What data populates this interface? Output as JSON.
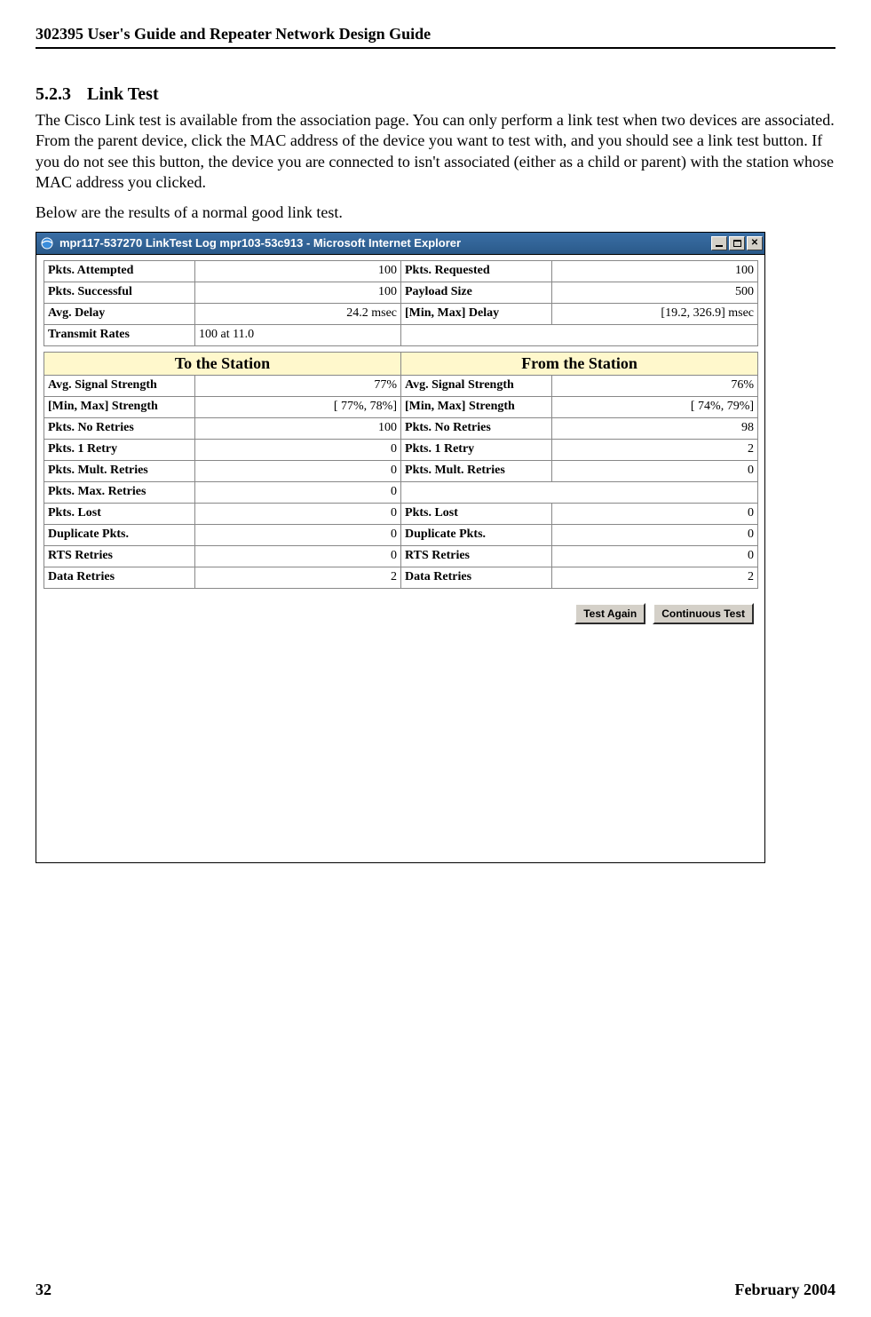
{
  "header": {
    "running_title": "302395 User's Guide and Repeater Network Design Guide"
  },
  "section": {
    "number": "5.2.3",
    "title": "Link Test",
    "para1": "The Cisco Link test is available from the association page. You can only perform a link test when two devices are associated. From the parent device, click the MAC address of the device you want to test with, and you should see a link test button. If you do not see this button, the device you are connected to isn't associated (either as a child or parent) with the station whose MAC address you clicked.",
    "para2": "Below are the results of a normal good link test."
  },
  "window": {
    "title": "mpr117-537270 LinkTest Log mpr103-53c913 - Microsoft Internet Explorer"
  },
  "top_rows": [
    {
      "l1": "Pkts. Attempted",
      "v1": "100",
      "l2": "Pkts. Requested",
      "v2": "100"
    },
    {
      "l1": "Pkts. Successful",
      "v1": "100",
      "l2": "Payload Size",
      "v2": "500"
    },
    {
      "l1": "Avg. Delay",
      "v1": "24.2 msec",
      "l2": "[Min, Max] Delay",
      "v2": "[19.2, 326.9] msec"
    },
    {
      "l1": "Transmit Rates",
      "v1": "100 at 11.0",
      "l2": "",
      "v2": ""
    }
  ],
  "station_headers": {
    "to": "To the Station",
    "from": "From the Station"
  },
  "station_rows": [
    {
      "l1": "Avg. Signal Strength",
      "v1": "77%",
      "l2": "Avg. Signal Strength",
      "v2": "76%"
    },
    {
      "l1": "[Min, Max] Strength",
      "v1": "[ 77%,  78%]",
      "l2": "[Min, Max] Strength",
      "v2": "[ 74%,  79%]"
    },
    {
      "l1": "Pkts. No Retries",
      "v1": "100",
      "l2": "Pkts. No Retries",
      "v2": "98"
    },
    {
      "l1": "Pkts. 1 Retry",
      "v1": "0",
      "l2": "Pkts. 1 Retry",
      "v2": "2"
    },
    {
      "l1": "Pkts. Mult. Retries",
      "v1": "0",
      "l2": "Pkts. Mult. Retries",
      "v2": "0"
    },
    {
      "l1": "Pkts. Max. Retries",
      "v1": "0",
      "l2": "",
      "v2": ""
    },
    {
      "l1": "Pkts. Lost",
      "v1": "0",
      "l2": "Pkts. Lost",
      "v2": "0"
    },
    {
      "l1": "Duplicate Pkts.",
      "v1": "0",
      "l2": "Duplicate Pkts.",
      "v2": "0"
    },
    {
      "l1": "RTS Retries",
      "v1": "0",
      "l2": "RTS Retries",
      "v2": "0"
    },
    {
      "l1": "Data Retries",
      "v1": "2",
      "l2": "Data Retries",
      "v2": "2"
    }
  ],
  "buttons": {
    "test_again": "Test Again",
    "continuous": "Continuous Test"
  },
  "footer": {
    "page": "32",
    "date": "February 2004"
  }
}
